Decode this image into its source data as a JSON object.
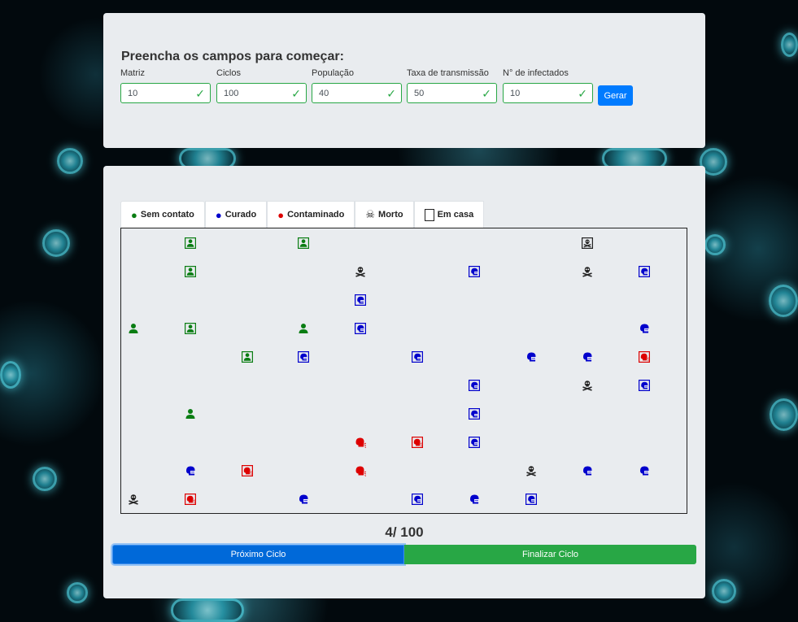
{
  "form": {
    "title": "Preencha os campos para começar:",
    "fields": [
      {
        "label": "Matriz",
        "value": "10"
      },
      {
        "label": "Ciclos",
        "value": "100"
      },
      {
        "label": "População",
        "value": "40"
      },
      {
        "label": "Taxa de transmissão",
        "value": "50"
      },
      {
        "label": "N° de infectados",
        "value": "10"
      }
    ],
    "generate_label": "Gerar"
  },
  "legend": {
    "tabs": [
      {
        "label": "Sem contato",
        "icon": "user-icon",
        "color": "#0a7d13"
      },
      {
        "label": "Curado",
        "icon": "masked-head-icon",
        "color": "#0000cc"
      },
      {
        "label": "Contaminado",
        "icon": "coughing-head-icon",
        "color": "#dd0000"
      },
      {
        "label": "Morto",
        "icon": "skull-crossbones-icon",
        "color": "#222222"
      },
      {
        "label": "Em casa",
        "icon": "house-square-icon",
        "color": "#222222"
      }
    ]
  },
  "simulation": {
    "cells": [
      {
        "row": 0,
        "col": 1,
        "state": "sem-contato",
        "home": true
      },
      {
        "row": 0,
        "col": 3,
        "state": "sem-contato",
        "home": true
      },
      {
        "row": 0,
        "col": 8,
        "state": "morto",
        "home": true
      },
      {
        "row": 1,
        "col": 1,
        "state": "sem-contato",
        "home": true
      },
      {
        "row": 1,
        "col": 4,
        "state": "morto",
        "home": false
      },
      {
        "row": 1,
        "col": 6,
        "state": "curado",
        "home": true
      },
      {
        "row": 1,
        "col": 8,
        "state": "morto",
        "home": false
      },
      {
        "row": 1,
        "col": 9,
        "state": "curado",
        "home": true
      },
      {
        "row": 2,
        "col": 4,
        "state": "curado",
        "home": true
      },
      {
        "row": 3,
        "col": 0,
        "state": "sem-contato",
        "home": false
      },
      {
        "row": 3,
        "col": 1,
        "state": "sem-contato",
        "home": true
      },
      {
        "row": 3,
        "col": 3,
        "state": "sem-contato",
        "home": false
      },
      {
        "row": 3,
        "col": 4,
        "state": "curado",
        "home": true
      },
      {
        "row": 3,
        "col": 9,
        "state": "curado",
        "home": false
      },
      {
        "row": 4,
        "col": 2,
        "state": "sem-contato",
        "home": true
      },
      {
        "row": 4,
        "col": 3,
        "state": "curado",
        "home": true
      },
      {
        "row": 4,
        "col": 5,
        "state": "curado",
        "home": true
      },
      {
        "row": 4,
        "col": 7,
        "state": "curado",
        "home": false
      },
      {
        "row": 4,
        "col": 8,
        "state": "curado",
        "home": false
      },
      {
        "row": 4,
        "col": 9,
        "state": "contaminado",
        "home": true
      },
      {
        "row": 5,
        "col": 6,
        "state": "curado",
        "home": true
      },
      {
        "row": 5,
        "col": 8,
        "state": "morto",
        "home": false
      },
      {
        "row": 5,
        "col": 9,
        "state": "curado",
        "home": true
      },
      {
        "row": 6,
        "col": 1,
        "state": "sem-contato",
        "home": false
      },
      {
        "row": 6,
        "col": 6,
        "state": "curado",
        "home": true
      },
      {
        "row": 7,
        "col": 4,
        "state": "contaminado",
        "home": false
      },
      {
        "row": 7,
        "col": 5,
        "state": "contaminado",
        "home": true
      },
      {
        "row": 7,
        "col": 6,
        "state": "curado",
        "home": true
      },
      {
        "row": 8,
        "col": 1,
        "state": "curado",
        "home": false
      },
      {
        "row": 8,
        "col": 2,
        "state": "contaminado",
        "home": true
      },
      {
        "row": 8,
        "col": 4,
        "state": "contaminado",
        "home": false
      },
      {
        "row": 8,
        "col": 7,
        "state": "morto",
        "home": false
      },
      {
        "row": 8,
        "col": 8,
        "state": "curado",
        "home": false
      },
      {
        "row": 8,
        "col": 9,
        "state": "curado",
        "home": false
      },
      {
        "row": 9,
        "col": 0,
        "state": "morto",
        "home": false
      },
      {
        "row": 9,
        "col": 1,
        "state": "contaminado",
        "home": true
      },
      {
        "row": 9,
        "col": 3,
        "state": "curado",
        "home": false
      },
      {
        "row": 9,
        "col": 5,
        "state": "curado",
        "home": true
      },
      {
        "row": 9,
        "col": 6,
        "state": "curado",
        "home": false
      },
      {
        "row": 9,
        "col": 7,
        "state": "curado",
        "home": true
      }
    ],
    "cycle_current": "4",
    "cycle_separator": "/ ",
    "cycle_total": "100",
    "next_label": "Próximo Ciclo",
    "finish_label": "Finalizar Ciclo"
  }
}
